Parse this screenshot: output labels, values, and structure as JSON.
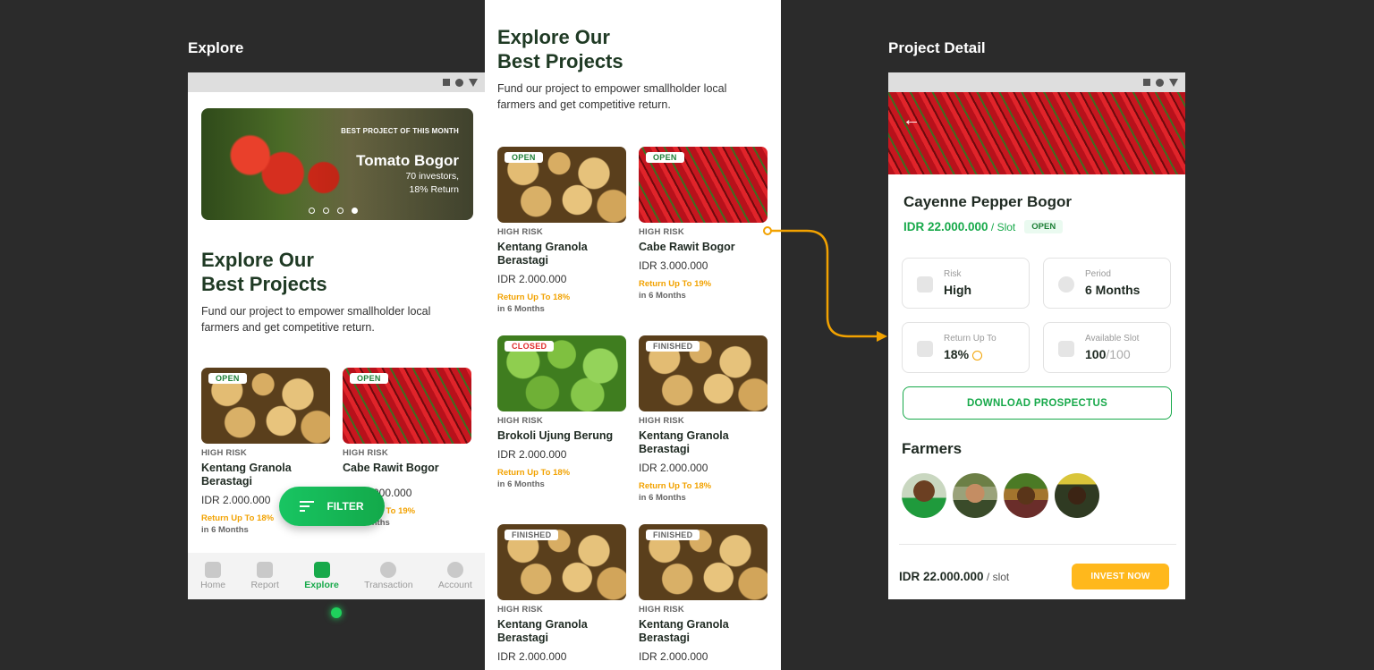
{
  "labels": {
    "explore": "Explore",
    "detail": "Project Detail"
  },
  "explore": {
    "hero": {
      "eyebrow": "BEST PROJECT OF THIS MONTH",
      "title": "Tomato Bogor",
      "investors": "70 investors,",
      "return": "18% Return"
    },
    "heading_line1": "Explore Our",
    "heading_line2": "Best Projects",
    "subtitle": "Fund our project to empower smallholder local farmers and get competitive return.",
    "cards": [
      {
        "badge": "OPEN",
        "risk": "HIGH RISK",
        "name": "Kentang Granola Berastagi",
        "price": "IDR 2.000.000",
        "ret": "Return Up To 18%",
        "period": "in 6 Months"
      },
      {
        "badge": "OPEN",
        "risk": "HIGH RISK",
        "name": "Cabe Rawit Bogor",
        "price": "IDR 3.000.000",
        "ret": "Return Up To 19%",
        "period": "in 6 Months"
      }
    ],
    "filter": "FILTER",
    "tabs": [
      "Home",
      "Report",
      "Explore",
      "Transaction",
      "Account"
    ]
  },
  "list": {
    "heading_line1": "Explore Our",
    "heading_line2": "Best Projects",
    "subtitle": "Fund our project to empower smallholder local farmers and get competitive return.",
    "cards": [
      {
        "badge": "OPEN",
        "risk": "HIGH RISK",
        "name": "Kentang Granola Berastagi",
        "price": "IDR 2.000.000",
        "ret": "Return Up To 18%",
        "period": "in 6 Months"
      },
      {
        "badge": "OPEN",
        "risk": "HIGH RISK",
        "name": "Cabe Rawit Bogor",
        "price": "IDR 3.000.000",
        "ret": "Return Up To 19%",
        "period": "in 6 Months"
      },
      {
        "badge": "CLOSED",
        "risk": "HIGH RISK",
        "name": "Brokoli Ujung Berung",
        "price": "IDR 2.000.000",
        "ret": "Return Up To 18%",
        "period": "in 6 Months"
      },
      {
        "badge": "FINISHED",
        "risk": "HIGH RISK",
        "name": "Kentang Granola Berastagi",
        "price": "IDR 2.000.000",
        "ret": "Return Up To 18%",
        "period": "in 6 Months"
      },
      {
        "badge": "FINISHED",
        "risk": "HIGH RISK",
        "name": "Kentang Granola Berastagi",
        "price": "IDR 2.000.000"
      },
      {
        "badge": "FINISHED",
        "risk": "HIGH RISK",
        "name": "Kentang Granola Berastagi",
        "price": "IDR 2.000.000"
      }
    ]
  },
  "detail": {
    "title": "Cayenne Pepper Bogor",
    "price": "IDR 22.000.000",
    "price_unit": " / Slot",
    "status": "OPEN",
    "stats": {
      "risk_label": "Risk",
      "risk_value": "High",
      "period_label": "Period",
      "period_value": "6 Months",
      "return_label": "Return Up To",
      "return_value": "18%",
      "slot_label": "Available Slot",
      "slot_value": "100",
      "slot_total": "/100"
    },
    "download": "DOWNLOAD PROSPECTUS",
    "farmers": "Farmers",
    "footer_price": "IDR 22.000.000",
    "footer_unit": " / slot",
    "invest": "INVEST NOW"
  },
  "colors": {
    "green": "#17a94a",
    "orange": "#f2a200",
    "bg": "#2b2b2b"
  }
}
